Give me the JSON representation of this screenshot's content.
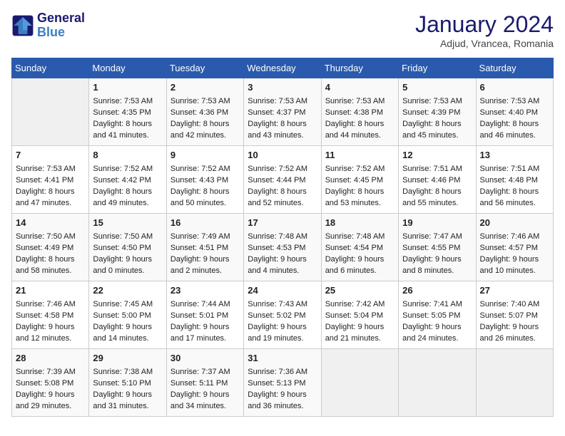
{
  "header": {
    "logo_line1": "General",
    "logo_line2": "Blue",
    "month_title": "January 2024",
    "subtitle": "Adjud, Vrancea, Romania"
  },
  "days_of_week": [
    "Sunday",
    "Monday",
    "Tuesday",
    "Wednesday",
    "Thursday",
    "Friday",
    "Saturday"
  ],
  "weeks": [
    [
      {
        "day": "",
        "info": ""
      },
      {
        "day": "1",
        "info": "Sunrise: 7:53 AM\nSunset: 4:35 PM\nDaylight: 8 hours\nand 41 minutes."
      },
      {
        "day": "2",
        "info": "Sunrise: 7:53 AM\nSunset: 4:36 PM\nDaylight: 8 hours\nand 42 minutes."
      },
      {
        "day": "3",
        "info": "Sunrise: 7:53 AM\nSunset: 4:37 PM\nDaylight: 8 hours\nand 43 minutes."
      },
      {
        "day": "4",
        "info": "Sunrise: 7:53 AM\nSunset: 4:38 PM\nDaylight: 8 hours\nand 44 minutes."
      },
      {
        "day": "5",
        "info": "Sunrise: 7:53 AM\nSunset: 4:39 PM\nDaylight: 8 hours\nand 45 minutes."
      },
      {
        "day": "6",
        "info": "Sunrise: 7:53 AM\nSunset: 4:40 PM\nDaylight: 8 hours\nand 46 minutes."
      }
    ],
    [
      {
        "day": "7",
        "info": "Sunrise: 7:53 AM\nSunset: 4:41 PM\nDaylight: 8 hours\nand 47 minutes."
      },
      {
        "day": "8",
        "info": "Sunrise: 7:52 AM\nSunset: 4:42 PM\nDaylight: 8 hours\nand 49 minutes."
      },
      {
        "day": "9",
        "info": "Sunrise: 7:52 AM\nSunset: 4:43 PM\nDaylight: 8 hours\nand 50 minutes."
      },
      {
        "day": "10",
        "info": "Sunrise: 7:52 AM\nSunset: 4:44 PM\nDaylight: 8 hours\nand 52 minutes."
      },
      {
        "day": "11",
        "info": "Sunrise: 7:52 AM\nSunset: 4:45 PM\nDaylight: 8 hours\nand 53 minutes."
      },
      {
        "day": "12",
        "info": "Sunrise: 7:51 AM\nSunset: 4:46 PM\nDaylight: 8 hours\nand 55 minutes."
      },
      {
        "day": "13",
        "info": "Sunrise: 7:51 AM\nSunset: 4:48 PM\nDaylight: 8 hours\nand 56 minutes."
      }
    ],
    [
      {
        "day": "14",
        "info": "Sunrise: 7:50 AM\nSunset: 4:49 PM\nDaylight: 8 hours\nand 58 minutes."
      },
      {
        "day": "15",
        "info": "Sunrise: 7:50 AM\nSunset: 4:50 PM\nDaylight: 9 hours\nand 0 minutes."
      },
      {
        "day": "16",
        "info": "Sunrise: 7:49 AM\nSunset: 4:51 PM\nDaylight: 9 hours\nand 2 minutes."
      },
      {
        "day": "17",
        "info": "Sunrise: 7:48 AM\nSunset: 4:53 PM\nDaylight: 9 hours\nand 4 minutes."
      },
      {
        "day": "18",
        "info": "Sunrise: 7:48 AM\nSunset: 4:54 PM\nDaylight: 9 hours\nand 6 minutes."
      },
      {
        "day": "19",
        "info": "Sunrise: 7:47 AM\nSunset: 4:55 PM\nDaylight: 9 hours\nand 8 minutes."
      },
      {
        "day": "20",
        "info": "Sunrise: 7:46 AM\nSunset: 4:57 PM\nDaylight: 9 hours\nand 10 minutes."
      }
    ],
    [
      {
        "day": "21",
        "info": "Sunrise: 7:46 AM\nSunset: 4:58 PM\nDaylight: 9 hours\nand 12 minutes."
      },
      {
        "day": "22",
        "info": "Sunrise: 7:45 AM\nSunset: 5:00 PM\nDaylight: 9 hours\nand 14 minutes."
      },
      {
        "day": "23",
        "info": "Sunrise: 7:44 AM\nSunset: 5:01 PM\nDaylight: 9 hours\nand 17 minutes."
      },
      {
        "day": "24",
        "info": "Sunrise: 7:43 AM\nSunset: 5:02 PM\nDaylight: 9 hours\nand 19 minutes."
      },
      {
        "day": "25",
        "info": "Sunrise: 7:42 AM\nSunset: 5:04 PM\nDaylight: 9 hours\nand 21 minutes."
      },
      {
        "day": "26",
        "info": "Sunrise: 7:41 AM\nSunset: 5:05 PM\nDaylight: 9 hours\nand 24 minutes."
      },
      {
        "day": "27",
        "info": "Sunrise: 7:40 AM\nSunset: 5:07 PM\nDaylight: 9 hours\nand 26 minutes."
      }
    ],
    [
      {
        "day": "28",
        "info": "Sunrise: 7:39 AM\nSunset: 5:08 PM\nDaylight: 9 hours\nand 29 minutes."
      },
      {
        "day": "29",
        "info": "Sunrise: 7:38 AM\nSunset: 5:10 PM\nDaylight: 9 hours\nand 31 minutes."
      },
      {
        "day": "30",
        "info": "Sunrise: 7:37 AM\nSunset: 5:11 PM\nDaylight: 9 hours\nand 34 minutes."
      },
      {
        "day": "31",
        "info": "Sunrise: 7:36 AM\nSunset: 5:13 PM\nDaylight: 9 hours\nand 36 minutes."
      },
      {
        "day": "",
        "info": ""
      },
      {
        "day": "",
        "info": ""
      },
      {
        "day": "",
        "info": ""
      }
    ]
  ]
}
